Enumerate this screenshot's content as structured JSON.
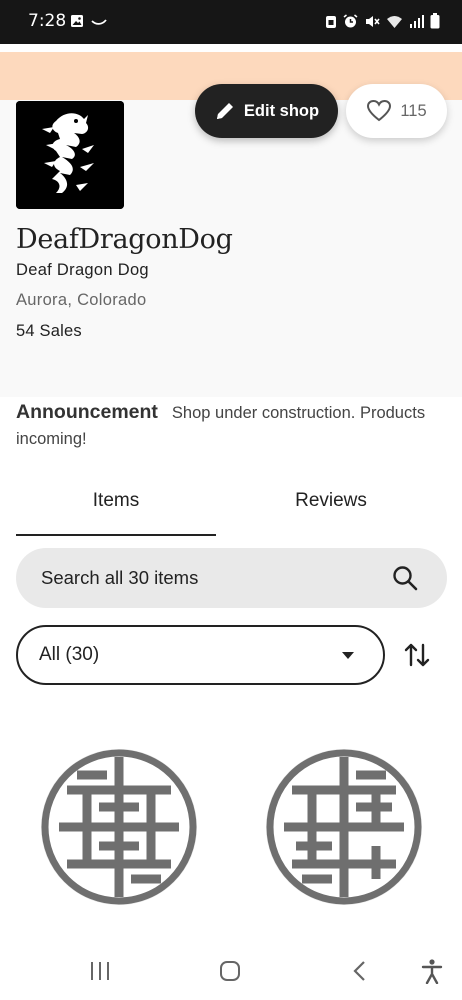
{
  "status_bar": {
    "time": "7:28",
    "left_icons": [
      "image-icon",
      "missed-call-icon"
    ],
    "right_icons": [
      "clipboard-icon",
      "alarm-icon",
      "mute-icon",
      "wifi-icon",
      "signal-icon",
      "battery-icon"
    ]
  },
  "colors": {
    "banner": "#fdd9bd",
    "profile_bg": "#f9f9f9",
    "dark_button": "#222222",
    "search_bg": "#e9e9e9"
  },
  "shop": {
    "name": "DeafDragonDog",
    "owner": "Deaf Dragon Dog",
    "location": "Aurora, Colorado",
    "sales": "54 Sales",
    "logo_icon": "dragon-logo-icon"
  },
  "actions": {
    "edit_label": "Edit shop",
    "favorites_count": "115"
  },
  "announcement": {
    "title": "Announcement",
    "text": "Shop under construction. Products incoming!"
  },
  "tabs": {
    "items": "Items",
    "reviews": "Reviews",
    "active": "Items"
  },
  "search": {
    "placeholder": "Search all 30 items"
  },
  "category": {
    "selected": "All (30)"
  },
  "listings": [
    {
      "icon": "circular-emblem-icon"
    },
    {
      "icon": "circular-emblem-icon"
    }
  ],
  "nav_bar": {
    "icons": [
      "recent-apps-icon",
      "home-icon",
      "back-icon",
      "accessibility-icon"
    ]
  }
}
